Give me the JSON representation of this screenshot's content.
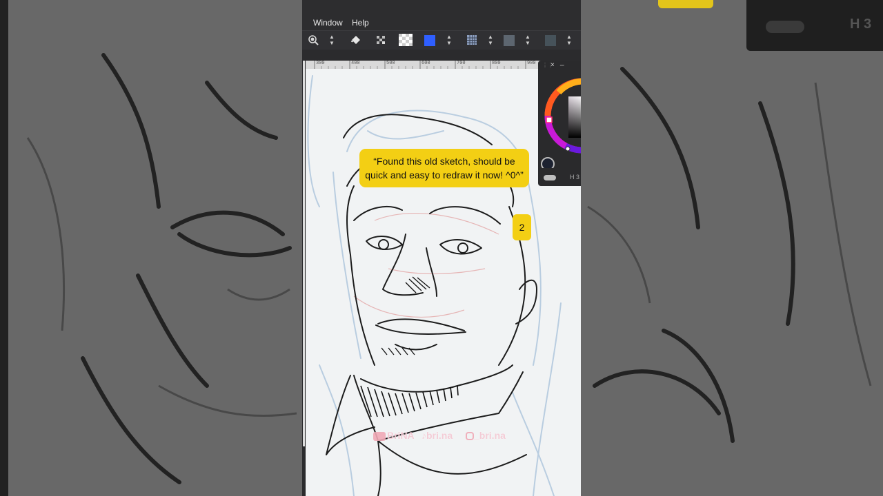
{
  "menu": {
    "window": "Window",
    "help": "Help"
  },
  "ruler": {
    "ticks": [
      "300",
      "400",
      "500",
      "600",
      "700",
      "800",
      "900"
    ]
  },
  "caption": {
    "text": "“Found this old sketch, should be quick and easy to redraw it now! ^0^”"
  },
  "badge": {
    "number": "2"
  },
  "color_panel": {
    "close_glyph": "×",
    "minimize_glyph": "_",
    "hue_label": "H 3"
  },
  "side_panel_right": {
    "hue_label": "H 3"
  },
  "watermark": {
    "youtube": "BriNA",
    "tiktok": "bri.na",
    "instagram": "_bri.na"
  },
  "colors": {
    "caption_yellow": "#f3cf14",
    "foreground_swatch": "#2f5fff",
    "menubar": "#2d2d2f"
  },
  "icons": [
    "zoom-icon",
    "fill-bucket-icon",
    "transparency-icon",
    "checker-icon",
    "grid-icon"
  ]
}
